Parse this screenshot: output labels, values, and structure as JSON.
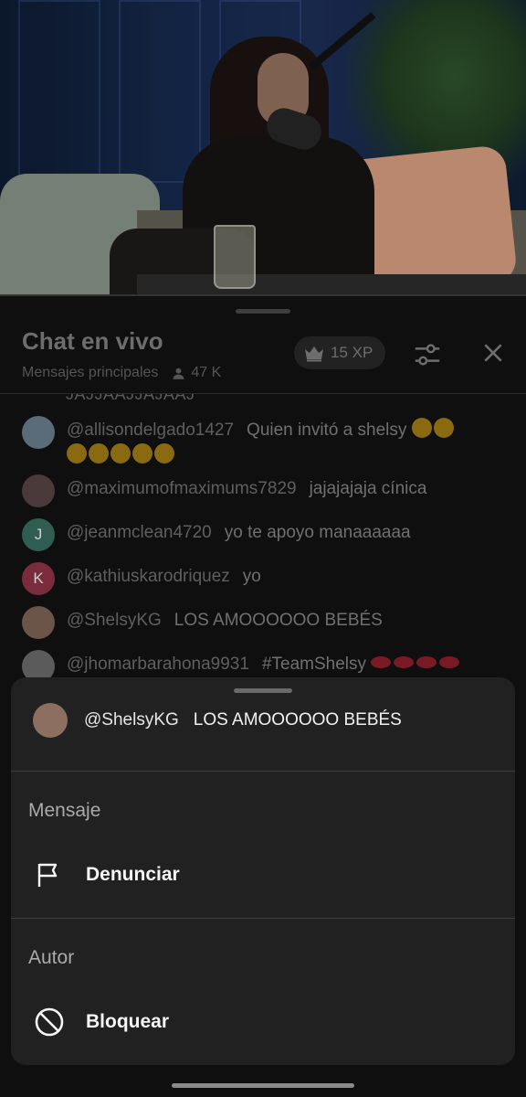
{
  "video": {
    "description_icon": "video-frame"
  },
  "chat": {
    "title": "Chat en vivo",
    "filter": "Mensajes principales",
    "viewers": "47 K",
    "xp": "15 XP",
    "cut_text": "JAJJAAJJAJAAJ",
    "messages": [
      {
        "author": "@allisondelgado1427",
        "text": "Quien invitó a shelsy",
        "avatar_color": "#5a6b7a",
        "avatar_letter": "",
        "emoji_line1": 2,
        "emoji_line2": 5
      },
      {
        "author": "@maximumofmaximums7829",
        "text": "jajajajaja cínica",
        "avatar_color": "#4a3a3a",
        "avatar_letter": ""
      },
      {
        "author": "@jeanmclean4720",
        "text": "yo te apoyo manaaaaaa",
        "avatar_color": "#2f5d52",
        "avatar_letter": "J"
      },
      {
        "author": "@kathiuskarodriquez",
        "text": "yo",
        "avatar_color": "#7a2b3c",
        "avatar_letter": "K"
      },
      {
        "author": "@ShelsyKG",
        "text": "LOS AMOOOOOO BEBÉS",
        "avatar_color": "#6a5548",
        "avatar_letter": ""
      },
      {
        "author": "@jhomarbarahona9931",
        "text": "#TeamShelsy",
        "avatar_color": "#5b5b5b",
        "avatar_letter": "",
        "lips": 4
      }
    ]
  },
  "sheet": {
    "selected_author": "@ShelsyKG",
    "selected_text": "LOS AMOOOOOO BEBÉS",
    "section_message": "Mensaje",
    "report_label": "Denunciar",
    "section_author": "Autor",
    "block_label": "Bloquear",
    "icons": {
      "report": "flag-icon",
      "block": "block-icon"
    }
  },
  "colors": {
    "sheet_bg": "#212121",
    "panel_bg": "#0f0f0f"
  }
}
